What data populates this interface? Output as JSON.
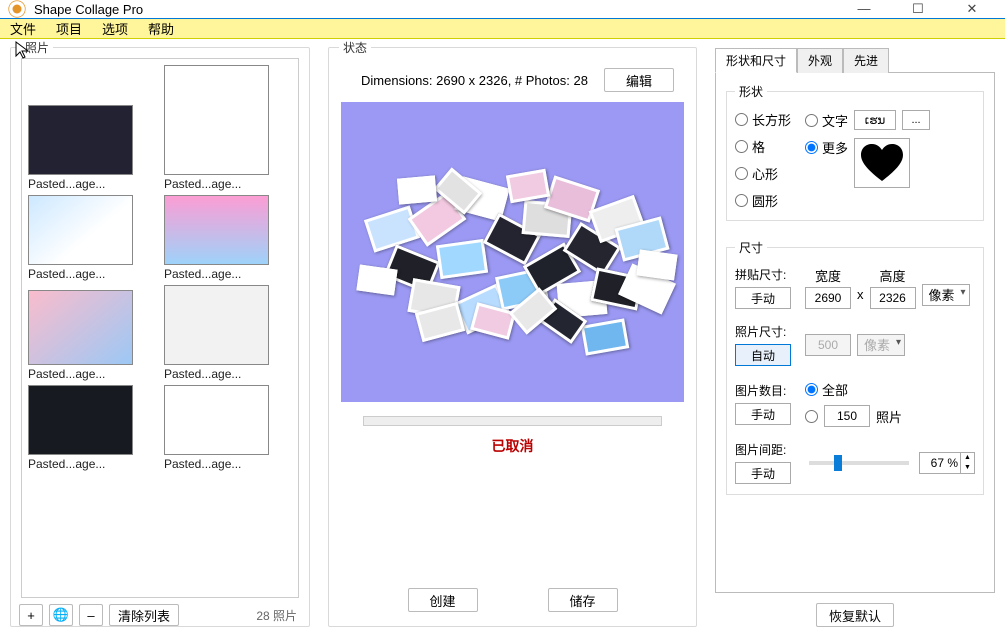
{
  "window": {
    "title": "Shape Collage Pro",
    "min": "—",
    "max": "☐",
    "close": "✕"
  },
  "menu": {
    "file": "文件",
    "project": "项目",
    "options": "选项",
    "help": "帮助"
  },
  "photos": {
    "panel_title": "照片",
    "items": [
      "Pasted...age...",
      "Pasted...age...",
      "Pasted...age...",
      "Pasted...age...",
      "Pasted...age...",
      "Pasted...age...",
      "Pasted...age...",
      "Pasted...age..."
    ],
    "add": "+",
    "web": "🌐",
    "remove": "–",
    "clear": "清除列表",
    "count": "28 照片"
  },
  "status": {
    "panel_title": "状态",
    "dimensions": "Dimensions: 2690 x 2326, # Photos: 28",
    "edit": "编辑",
    "cancelled": "已取消",
    "create": "创建",
    "save": "储存"
  },
  "right": {
    "tabs": {
      "shape_size": "形状和尺寸",
      "appearance": "外观",
      "advanced": "先进"
    },
    "shape": {
      "legend": "形状",
      "rect": "长方形",
      "grid": "格",
      "heart": "心形",
      "circle": "圆形",
      "text": "文字",
      "text_value": "ເຮນ",
      "more": "更多",
      "browse": "..."
    },
    "size": {
      "legend": "尺寸",
      "collage": "拼贴尺寸:",
      "manual": "手动",
      "auto": "自动",
      "width_label": "宽度",
      "height_label": "高度",
      "width": "2690",
      "height": "2326",
      "x": "x",
      "unit_pixels": "像素",
      "photo_size": "照片尺寸:",
      "photo_px": "500",
      "photo_count": "图片数目:",
      "all": "全部",
      "count_val": "150",
      "photos_suffix": "照片",
      "spacing": "图片间距:",
      "spacing_val": "67 %"
    },
    "restore": "恢复默认"
  }
}
